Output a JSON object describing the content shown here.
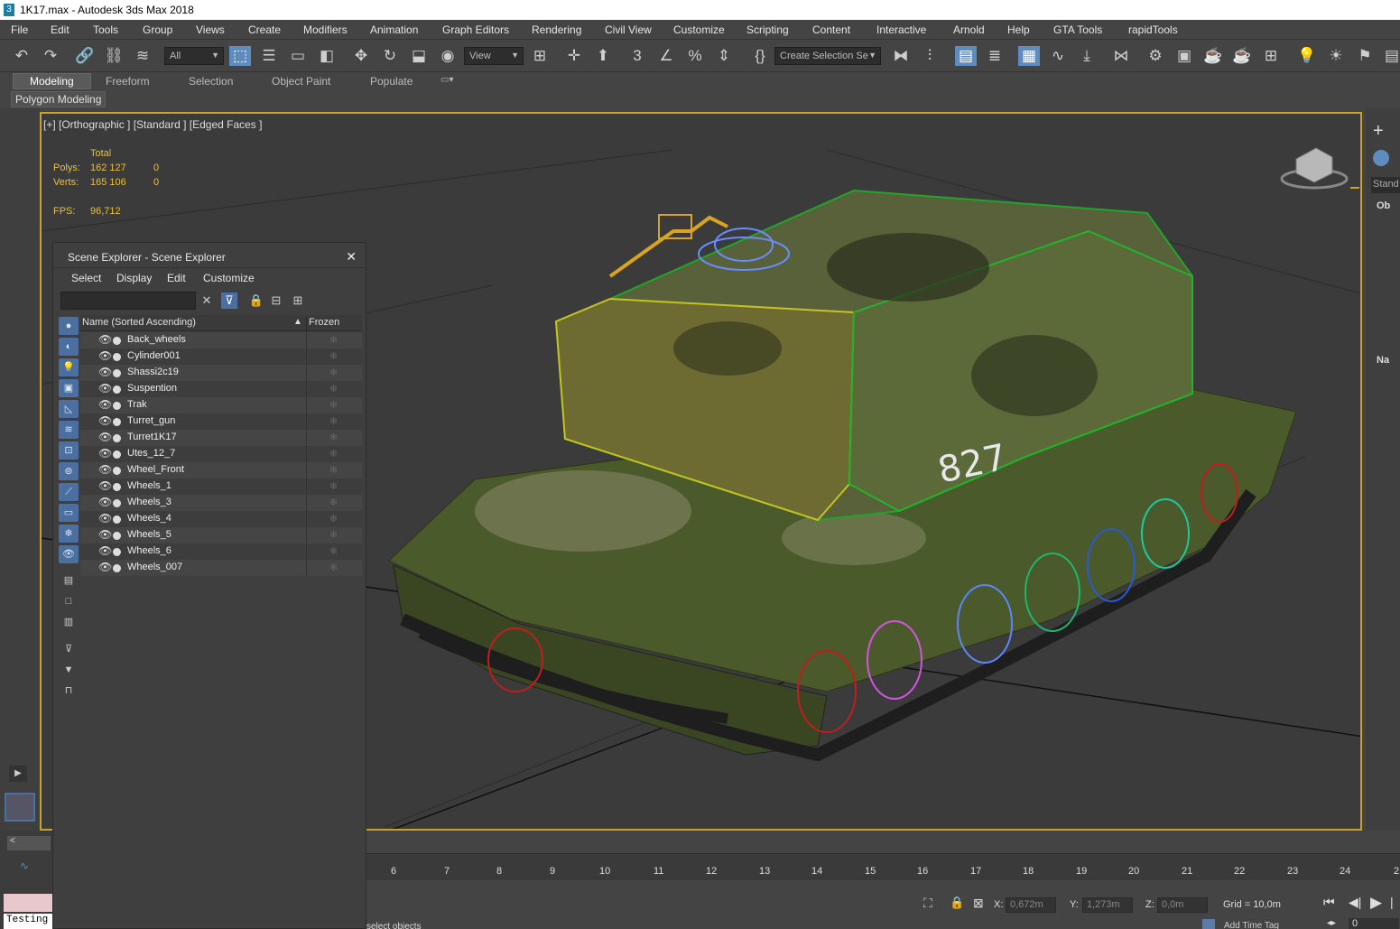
{
  "window": {
    "title": "1K17.max - Autodesk 3ds Max 2018",
    "logo": "3"
  },
  "menu": [
    "File",
    "Edit",
    "Tools",
    "Group",
    "Views",
    "Create",
    "Modifiers",
    "Animation",
    "Graph Editors",
    "Rendering",
    "Civil View",
    "Customize",
    "Scripting",
    "Content",
    "Interactive",
    "Arnold",
    "Help",
    "GTA Tools",
    "rapidTools"
  ],
  "toolbar": {
    "filter": "All",
    "refcoord": "View",
    "selection_set": "Create Selection Se"
  },
  "ribbon": {
    "tabs": [
      "Modeling",
      "Freeform",
      "Selection",
      "Object Paint",
      "Populate"
    ],
    "active": "Modeling",
    "sub": "Polygon Modeling"
  },
  "viewport": {
    "label": "[+] [Orthographic ] [Standard ] [Edged Faces ]",
    "stats": {
      "total_label": "Total",
      "polys_label": "Polys:",
      "polys": "162 127",
      "polys_sel": "0",
      "verts_label": "Verts:",
      "verts": "165 106",
      "verts_sel": "0",
      "fps_label": "FPS:",
      "fps": "96,712"
    },
    "hull_number": "827"
  },
  "scene_explorer": {
    "title": "Scene Explorer - Scene Explorer",
    "menu": [
      "Select",
      "Display",
      "Edit",
      "Customize"
    ],
    "col_name": "Name (Sorted Ascending)",
    "col_frozen": "Frozen",
    "items": [
      "Back_wheels",
      "Cylinder001",
      "Shassi2c19",
      "Suspention",
      "Trak",
      "Turret_gun",
      "Turret1K17",
      "Utes_12_7",
      "Wheel_Front",
      "Wheels_1",
      "Wheels_3",
      "Wheels_4",
      "Wheels_5",
      "Wheels_6",
      "Wheels_007"
    ]
  },
  "timeline": {
    "ticks": [
      "6",
      "7",
      "8",
      "9",
      "10",
      "11",
      "12",
      "13",
      "14",
      "15",
      "16",
      "17",
      "18",
      "19",
      "20",
      "21",
      "22",
      "23",
      "24",
      "2"
    ]
  },
  "status": {
    "x_label": "X:",
    "x": "0,672m",
    "y_label": "Y:",
    "y": "1,273m",
    "z_label": "Z:",
    "z": "0,0m",
    "grid": "Grid = 10,0m",
    "prompt": "select objects",
    "add_time_tag": "Add Time Tag",
    "frame": "0",
    "script_listener": "Testing"
  },
  "right_panel": {
    "stand": "Stand",
    "ob": "Ob",
    "na": "Na"
  },
  "colors": {
    "viewport_border": "#c9a227",
    "active_blue": "#5e8cbf",
    "stats_yellow": "#e8c040"
  }
}
